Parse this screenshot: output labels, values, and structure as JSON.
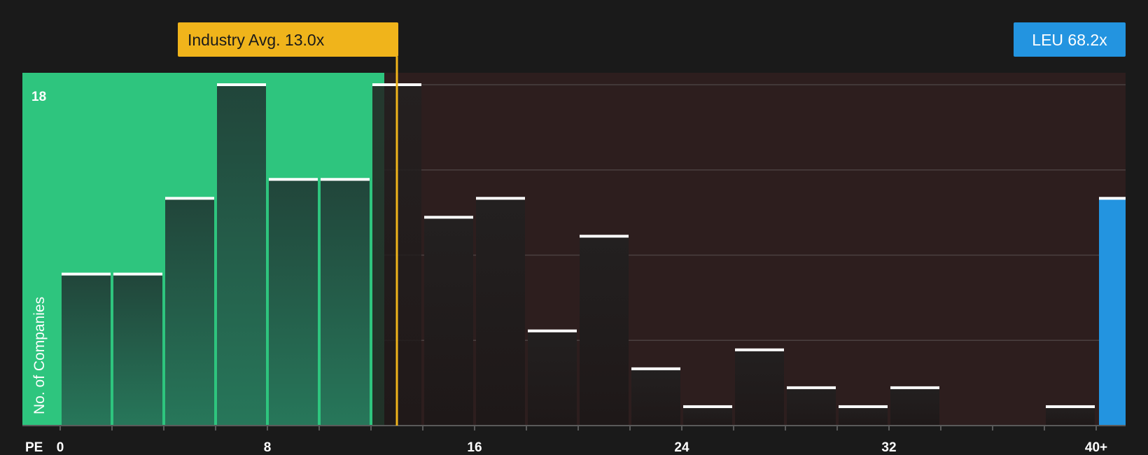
{
  "chart_data": {
    "type": "bar",
    "title": "",
    "xlabel": "PE",
    "ylabel": "No. of Companies",
    "x_ticks": [
      "0",
      "8",
      "16",
      "24",
      "32",
      "40+"
    ],
    "y_tick_top": "18",
    "ylim": [
      0,
      18
    ],
    "xlim": [
      0,
      42
    ],
    "bin_width": 2,
    "bins": [
      {
        "x0": 0,
        "value": 8
      },
      {
        "x0": 2,
        "value": 8
      },
      {
        "x0": 4,
        "value": 12
      },
      {
        "x0": 6,
        "value": 18
      },
      {
        "x0": 8,
        "value": 13
      },
      {
        "x0": 10,
        "value": 13
      },
      {
        "x0": 12,
        "value": 18
      },
      {
        "x0": 14,
        "value": 11
      },
      {
        "x0": 16,
        "value": 12
      },
      {
        "x0": 18,
        "value": 5
      },
      {
        "x0": 20,
        "value": 10
      },
      {
        "x0": 22,
        "value": 3
      },
      {
        "x0": 24,
        "value": 1
      },
      {
        "x0": 26,
        "value": 4
      },
      {
        "x0": 28,
        "value": 2
      },
      {
        "x0": 30,
        "value": 1
      },
      {
        "x0": 32,
        "value": 2
      },
      {
        "x0": 34,
        "value": 0
      },
      {
        "x0": 36,
        "value": 0
      },
      {
        "x0": 38,
        "value": 1
      }
    ],
    "highlight_bar": {
      "label": "LEU 68.2x",
      "ticker": "LEU",
      "value_label": "68.2x",
      "count": 12,
      "color": "#2394e0"
    },
    "industry_avg": {
      "label": "Industry Avg. 13.0x",
      "value": 13.0,
      "color": "#f0b41b"
    },
    "colors": {
      "below_avg_region": "#2ec57e",
      "above_avg_region": "#2d1e1e",
      "background": "#1a1a1a",
      "bar_cap": "#ffffff",
      "grid": "#4a4040"
    },
    "gridlines": true
  }
}
